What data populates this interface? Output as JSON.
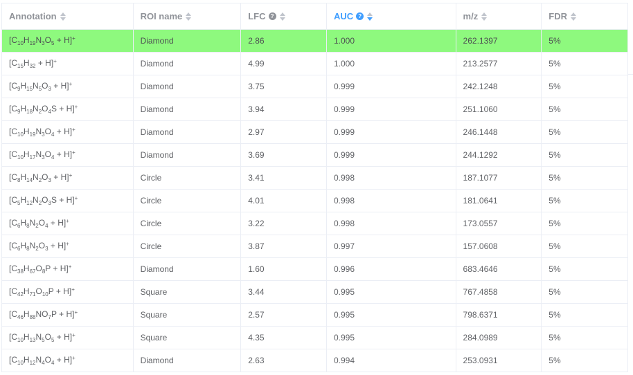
{
  "columns": [
    {
      "label": "Annotation",
      "help": false,
      "sort": "none"
    },
    {
      "label": "ROI name",
      "help": false,
      "sort": "none"
    },
    {
      "label": "LFC",
      "help": true,
      "sort": "none"
    },
    {
      "label": "AUC",
      "help": true,
      "sort": "descending"
    },
    {
      "label": "m/z",
      "help": false,
      "sort": "none"
    },
    {
      "label": "FDR",
      "help": false,
      "sort": "none"
    }
  ],
  "help_glyph": "?",
  "colors": {
    "selected_row": "#8ef97e",
    "active_sort": "#409eff"
  },
  "rows": [
    {
      "formula": [
        [
          "C",
          "10"
        ],
        [
          "H",
          "19"
        ],
        [
          "N",
          "3"
        ],
        [
          "O",
          "5"
        ]
      ],
      "adduct": " + H]",
      "roi": "Diamond",
      "lfc": "2.86",
      "auc": "1.000",
      "mz": "262.1397",
      "fdr": "5%",
      "selected": true
    },
    {
      "formula": [
        [
          "C",
          "15"
        ],
        [
          "H",
          "32"
        ]
      ],
      "adduct": " + H]",
      "roi": "Diamond",
      "lfc": "4.99",
      "auc": "1.000",
      "mz": "213.2577",
      "fdr": "5%"
    },
    {
      "formula": [
        [
          "C",
          "9"
        ],
        [
          "H",
          "15"
        ],
        [
          "N",
          "5"
        ],
        [
          "O",
          "3"
        ]
      ],
      "adduct": " + H]",
      "roi": "Diamond",
      "lfc": "3.75",
      "auc": "0.999",
      "mz": "242.1248",
      "fdr": "5%"
    },
    {
      "formula": [
        [
          "C",
          "9"
        ],
        [
          "H",
          "18"
        ],
        [
          "N",
          "2"
        ],
        [
          "O",
          "4"
        ],
        [
          "S",
          ""
        ]
      ],
      "adduct": " + H]",
      "roi": "Diamond",
      "lfc": "3.94",
      "auc": "0.999",
      "mz": "251.1060",
      "fdr": "5%"
    },
    {
      "formula": [
        [
          "C",
          "10"
        ],
        [
          "H",
          "19"
        ],
        [
          "N",
          "3"
        ],
        [
          "O",
          "4"
        ]
      ],
      "adduct": " + H]",
      "roi": "Diamond",
      "lfc": "2.97",
      "auc": "0.999",
      "mz": "246.1448",
      "fdr": "5%"
    },
    {
      "formula": [
        [
          "C",
          "10"
        ],
        [
          "H",
          "17"
        ],
        [
          "N",
          "3"
        ],
        [
          "O",
          "4"
        ]
      ],
      "adduct": " + H]",
      "roi": "Diamond",
      "lfc": "3.69",
      "auc": "0.999",
      "mz": "244.1292",
      "fdr": "5%"
    },
    {
      "formula": [
        [
          "C",
          "8"
        ],
        [
          "H",
          "14"
        ],
        [
          "N",
          "2"
        ],
        [
          "O",
          "3"
        ]
      ],
      "adduct": " + H]",
      "roi": "Circle",
      "lfc": "3.41",
      "auc": "0.998",
      "mz": "187.1077",
      "fdr": "5%"
    },
    {
      "formula": [
        [
          "C",
          "5"
        ],
        [
          "H",
          "12"
        ],
        [
          "N",
          "2"
        ],
        [
          "O",
          "3"
        ],
        [
          "S",
          ""
        ]
      ],
      "adduct": " + H]",
      "roi": "Circle",
      "lfc": "4.01",
      "auc": "0.998",
      "mz": "181.0641",
      "fdr": "5%"
    },
    {
      "formula": [
        [
          "C",
          "6"
        ],
        [
          "H",
          "8"
        ],
        [
          "N",
          "2"
        ],
        [
          "O",
          "4"
        ]
      ],
      "adduct": " + H]",
      "roi": "Circle",
      "lfc": "3.22",
      "auc": "0.998",
      "mz": "173.0557",
      "fdr": "5%"
    },
    {
      "formula": [
        [
          "C",
          "6"
        ],
        [
          "H",
          "8"
        ],
        [
          "N",
          "2"
        ],
        [
          "O",
          "3"
        ]
      ],
      "adduct": " + H]",
      "roi": "Circle",
      "lfc": "3.87",
      "auc": "0.997",
      "mz": "157.0608",
      "fdr": "5%"
    },
    {
      "formula": [
        [
          "C",
          "38"
        ],
        [
          "H",
          "67"
        ],
        [
          "O",
          "8"
        ],
        [
          "P",
          ""
        ]
      ],
      "adduct": " + H]",
      "roi": "Diamond",
      "lfc": "1.60",
      "auc": "0.996",
      "mz": "683.4646",
      "fdr": "5%"
    },
    {
      "formula": [
        [
          "C",
          "42"
        ],
        [
          "H",
          "71"
        ],
        [
          "O",
          "10"
        ],
        [
          "P",
          ""
        ]
      ],
      "adduct": " + H]",
      "roi": "Square",
      "lfc": "3.44",
      "auc": "0.995",
      "mz": "767.4858",
      "fdr": "5%"
    },
    {
      "formula": [
        [
          "C",
          "46"
        ],
        [
          "H",
          "88"
        ],
        [
          "N",
          ""
        ],
        [
          "O",
          "7"
        ],
        [
          "P",
          ""
        ]
      ],
      "adduct": " + H]",
      "roi": "Square",
      "lfc": "2.57",
      "auc": "0.995",
      "mz": "798.6371",
      "fdr": "5%"
    },
    {
      "formula": [
        [
          "C",
          "10"
        ],
        [
          "H",
          "13"
        ],
        [
          "N",
          "5"
        ],
        [
          "O",
          "5"
        ]
      ],
      "adduct": " + H]",
      "roi": "Square",
      "lfc": "4.35",
      "auc": "0.995",
      "mz": "284.0989",
      "fdr": "5%"
    },
    {
      "formula": [
        [
          "C",
          "10"
        ],
        [
          "H",
          "12"
        ],
        [
          "N",
          "4"
        ],
        [
          "O",
          "4"
        ]
      ],
      "adduct": " + H]",
      "roi": "Diamond",
      "lfc": "2.63",
      "auc": "0.994",
      "mz": "253.0931",
      "fdr": "5%"
    }
  ],
  "charge": "+"
}
